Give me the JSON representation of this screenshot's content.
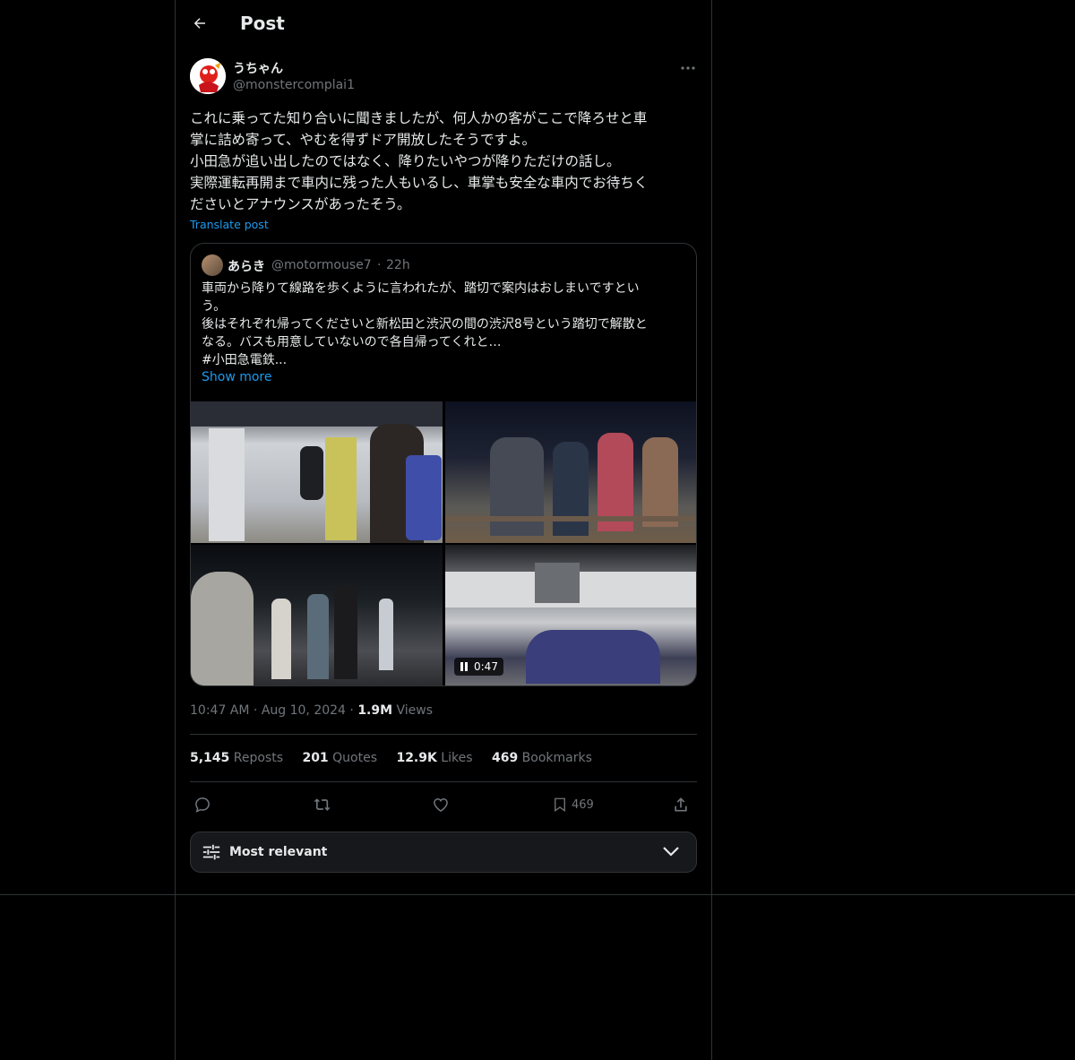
{
  "header": {
    "title": "Post"
  },
  "post": {
    "author_name": "うちゃん",
    "author_handle": "@monstercomplai1",
    "text_lines": [
      "これに乗ってた知り合いに聞きましたが、何人かの客がここで降ろせと車",
      "掌に詰め寄って、やむを得ずドア開放したそうですよ。",
      "小田急が追い出したのではなく、降りたいやつが降りただけの話し。",
      "実際運転再開まで車内に残った人もいるし、車掌も安全な車内でお待ちく",
      "ださいとアナウンスがあったそう。"
    ],
    "translate_label": "Translate post",
    "time": "10:47 AM",
    "date": "Aug 10, 2024",
    "separator": "·",
    "views_count": "1.9M",
    "views_label": "Views"
  },
  "quote": {
    "author_name": "あらき",
    "author_handle": "@motormouse7",
    "separator": "·",
    "time": "22h",
    "text_lines": [
      "車両から降りて線路を歩くように言われたが、踏切で案内はおしまいですとい",
      "う。",
      "後はそれぞれ帰ってくださいと新松田と渋沢の間の渋沢8号という踏切で解散と",
      "なる。バスも用意していないので各自帰ってくれと…",
      "#小田急電鉄..."
    ],
    "show_more_label": "Show more",
    "video_duration": "0:47"
  },
  "stats": {
    "reposts_count": "5,145",
    "reposts_label": "Reposts",
    "quotes_count": "201",
    "quotes_label": "Quotes",
    "likes_count": "12.9K",
    "likes_label": "Likes",
    "bookmarks_count": "469",
    "bookmarks_label": "Bookmarks"
  },
  "actions": {
    "bookmark_count": "469"
  },
  "sort": {
    "label": "Most relevant"
  },
  "icons": [
    "back-arrow-icon",
    "more-icon",
    "reply-icon",
    "repost-icon",
    "like-icon",
    "bookmark-icon",
    "share-icon",
    "sliders-icon",
    "chevron-down-icon",
    "pause-icon"
  ],
  "colors": {
    "accent": "#1d9bf0",
    "background": "#000000",
    "border": "#2f3336",
    "muted_text": "#71767b"
  }
}
